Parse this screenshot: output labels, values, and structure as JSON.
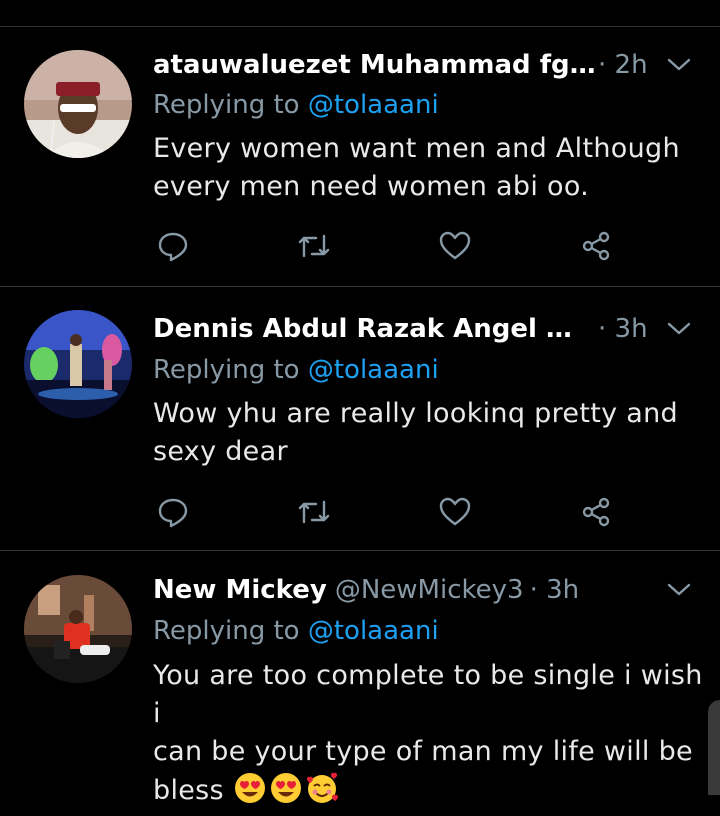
{
  "colors": {
    "background": "#000000",
    "divider": "#2f3336",
    "secondary_text": "#8899a6",
    "mention": "#1da1f2",
    "primary_text": "#e7e9ea"
  },
  "tweets": [
    {
      "name": "atauwaluezet Muhammad fge …",
      "handle": "",
      "time": "· 2h",
      "replying_prefix": "Replying to ",
      "replying_to": "@tolaaani",
      "text_lines": [
        "Every women want men and Although",
        "every men need women abi oo."
      ],
      "icons": [
        "reply-icon",
        "retweet-icon",
        "like-icon",
        "share-icon"
      ]
    },
    {
      "name": "Dennis Abdul Razak Angel Hac...",
      "handle": "",
      "time": "· 3h",
      "replying_prefix": "Replying to ",
      "replying_to": "@tolaaani",
      "text_lines": [
        "Wow yhu are really lookinq pretty and",
        "sexy dear"
      ],
      "icons": [
        "reply-icon",
        "retweet-icon",
        "like-icon",
        "share-icon"
      ]
    },
    {
      "name": "New Mickey",
      "handle": "@NewMickey3",
      "time": "· 3h",
      "replying_prefix": "Replying to ",
      "replying_to": "@tolaaani",
      "text_lines": [
        "You are too complete to be single i wish i",
        "can be your type of man my life will be",
        "bless"
      ],
      "emojis": [
        "heart-eyes-emoji",
        "heart-eyes-emoji",
        "smiling-face-with-hearts-emoji"
      ]
    }
  ]
}
